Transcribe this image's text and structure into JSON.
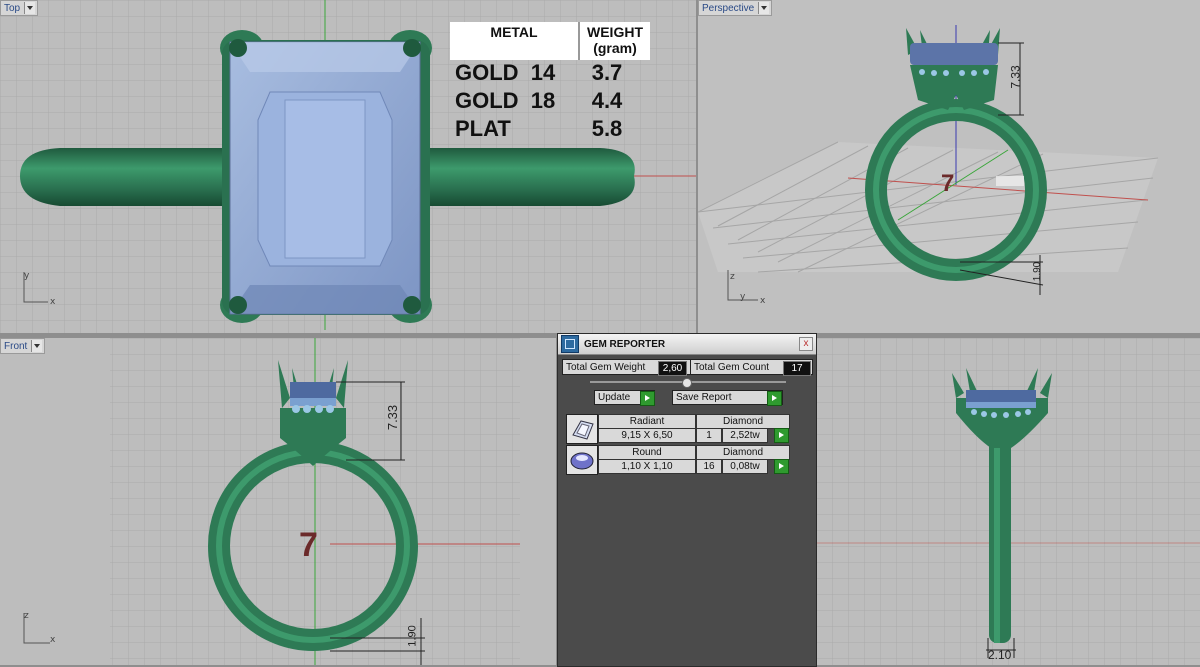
{
  "viewports": {
    "top": {
      "label": "Top",
      "axis_x": "x",
      "axis_y": "y"
    },
    "perspective": {
      "label": "Perspective",
      "axis_x": "x",
      "axis_y": "y",
      "axis_z": "z",
      "size_label": "7",
      "dim_height": "7.33",
      "dim_shank": "1.90"
    },
    "front": {
      "label": "Front",
      "axis_x": "x",
      "axis_z": "z",
      "size_label": "7",
      "dim_height": "7.33",
      "dim_shank": "1.90"
    },
    "right": {
      "dim_width": "2.10"
    }
  },
  "weight_table": {
    "header_metal": "METAL",
    "header_weight": "WEIGHT (gram)",
    "rows": [
      {
        "metal": "GOLD  14",
        "weight": "3.7"
      },
      {
        "metal": "GOLD  18",
        "weight": "4.4"
      },
      {
        "metal": "PLAT",
        "weight": "5.8"
      }
    ]
  },
  "gem_reporter": {
    "title": "GEM REPORTER",
    "close": "x",
    "total_weight_label": "Total Gem Weight",
    "total_weight_value": "2,60",
    "total_count_label": "Total Gem Count",
    "total_count_value": "17",
    "update_label": "Update",
    "save_label": "Save Report",
    "gems": [
      {
        "shape": "Radiant",
        "material": "Diamond",
        "size": "9,15 X 6,50",
        "count": "1",
        "weight": "2,52tw",
        "icon": "radiant-gem-icon"
      },
      {
        "shape": "Round",
        "material": "Diamond",
        "size": "1,10 X 1,10",
        "count": "16",
        "weight": "0,08tw",
        "icon": "round-gem-icon"
      }
    ]
  },
  "colors": {
    "metal": "#2e7a55",
    "stone": "#8fa9d6",
    "viewport_bg": "#bdbdbd",
    "grid": "#a9a9a9",
    "axis_red": "#c0504d",
    "axis_green": "#3aa63a",
    "dim_line": "#222222",
    "size_label": "#6b2a2a"
  }
}
